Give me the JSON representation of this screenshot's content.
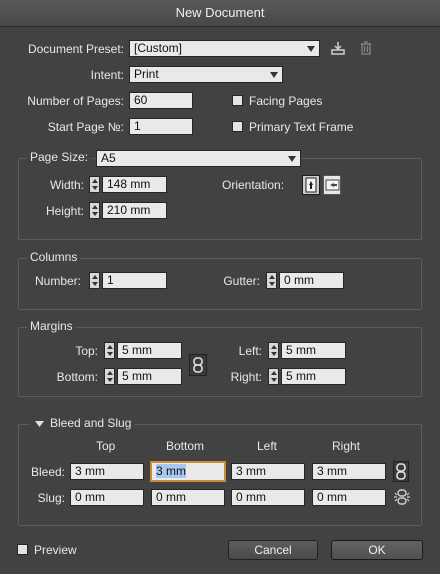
{
  "window": {
    "title": "New Document"
  },
  "preset": {
    "label": "Document Preset:",
    "value": "[Custom]"
  },
  "intent": {
    "label": "Intent:",
    "value": "Print"
  },
  "pages": {
    "number_label": "Number of Pages:",
    "number_value": "60",
    "start_label": "Start Page №:",
    "start_value": "1",
    "facing_label": "Facing Pages",
    "primary_label": "Primary Text Frame"
  },
  "page_size": {
    "label": "Page Size:",
    "value": "A5",
    "width_label": "Width:",
    "width_value": "148 mm",
    "height_label": "Height:",
    "height_value": "210 mm",
    "orientation_label": "Orientation:"
  },
  "columns": {
    "legend": "Columns",
    "number_label": "Number:",
    "number_value": "1",
    "gutter_label": "Gutter:",
    "gutter_value": "0 mm"
  },
  "margins": {
    "legend": "Margins",
    "top_label": "Top:",
    "top_value": "5 mm",
    "bottom_label": "Bottom:",
    "bottom_value": "5 mm",
    "left_label": "Left:",
    "left_value": "5 mm",
    "right_label": "Right:",
    "right_value": "5 mm"
  },
  "bleed": {
    "legend": "Bleed and Slug",
    "headers": [
      "Top",
      "Bottom",
      "Left",
      "Right"
    ],
    "bleed_label": "Bleed:",
    "bleed_values": [
      "3 mm",
      "3 mm",
      "3 mm",
      "3 mm"
    ],
    "slug_label": "Slug:",
    "slug_values": [
      "0 mm",
      "0 mm",
      "0 mm",
      "0 mm"
    ]
  },
  "footer": {
    "preview_label": "Preview",
    "cancel_label": "Cancel",
    "ok_label": "OK"
  }
}
